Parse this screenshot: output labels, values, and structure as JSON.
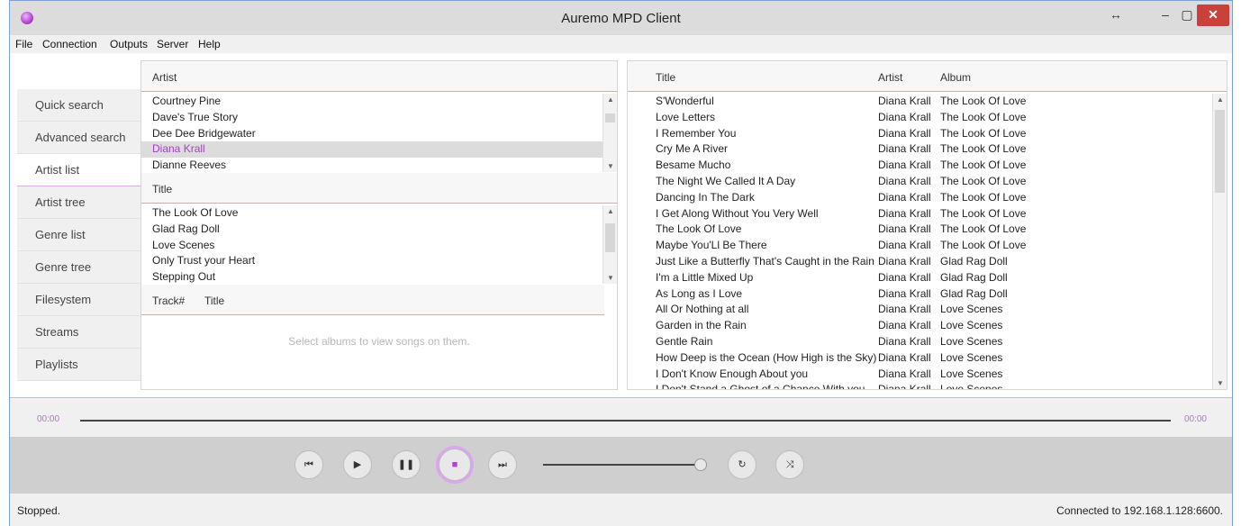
{
  "window": {
    "title": "Auremo MPD Client"
  },
  "titlebar_buttons": {
    "resize": "↔",
    "minimize": "–",
    "maximize": "▢",
    "close": "✕"
  },
  "menu": [
    "File",
    "Connection",
    "Outputs",
    "Server",
    "Help"
  ],
  "sidebar": [
    {
      "label": "Quick search"
    },
    {
      "label": "Advanced search"
    },
    {
      "label": "Artist list",
      "active": true
    },
    {
      "label": "Artist tree"
    },
    {
      "label": "Genre list"
    },
    {
      "label": "Genre tree"
    },
    {
      "label": "Filesystem"
    },
    {
      "label": "Streams"
    },
    {
      "label": "Playlists"
    }
  ],
  "artists": {
    "header": "Artist",
    "items": [
      "Courtney Pine",
      "Dave's True Story",
      "Dee Dee Bridgewater",
      "Diana Krall",
      "Dianne Reeves"
    ],
    "selected_index": 3
  },
  "albums": {
    "header": "Title",
    "items": [
      "The Look Of Love",
      "Glad Rag Doll",
      "Love Scenes",
      "Only Trust your Heart",
      "Stepping Out"
    ]
  },
  "tracks": {
    "header_track": "Track#",
    "header_title": "Title",
    "empty_message": "Select albums to view songs on them."
  },
  "songs": {
    "headers": {
      "title": "Title",
      "artist": "Artist",
      "album": "Album"
    },
    "rows": [
      {
        "title": "S'Wonderful",
        "artist": "Diana Krall",
        "album": "The Look Of Love"
      },
      {
        "title": "Love Letters",
        "artist": "Diana Krall",
        "album": "The Look Of Love"
      },
      {
        "title": "I Remember You",
        "artist": "Diana Krall",
        "album": "The Look Of Love"
      },
      {
        "title": "Cry Me A River",
        "artist": "Diana Krall",
        "album": "The Look Of Love"
      },
      {
        "title": "Besame Mucho",
        "artist": "Diana Krall",
        "album": "The Look Of Love"
      },
      {
        "title": "The Night We Called It A Day",
        "artist": "Diana Krall",
        "album": "The Look Of Love"
      },
      {
        "title": "Dancing In The Dark",
        "artist": "Diana Krall",
        "album": "The Look Of Love"
      },
      {
        "title": "I Get Along Without You Very Well",
        "artist": "Diana Krall",
        "album": "The Look Of Love"
      },
      {
        "title": "The Look Of Love",
        "artist": "Diana Krall",
        "album": "The Look Of Love"
      },
      {
        "title": "Maybe You'Ll Be There",
        "artist": "Diana Krall",
        "album": "The Look Of Love"
      },
      {
        "title": "Just Like a Butterfly That's Caught in the Rain",
        "artist": "Diana Krall",
        "album": "Glad Rag Doll"
      },
      {
        "title": "I'm a Little Mixed Up",
        "artist": "Diana Krall",
        "album": "Glad Rag Doll"
      },
      {
        "title": "As Long as I Love",
        "artist": "Diana Krall",
        "album": "Glad Rag Doll"
      },
      {
        "title": "All Or Nothing at all",
        "artist": "Diana Krall",
        "album": "Love Scenes"
      },
      {
        "title": "Garden in the Rain",
        "artist": "Diana Krall",
        "album": "Love Scenes"
      },
      {
        "title": "Gentle Rain",
        "artist": "Diana Krall",
        "album": "Love Scenes"
      },
      {
        "title": "How Deep is the Ocean (How High is the Sky)",
        "artist": "Diana Krall",
        "album": "Love Scenes"
      },
      {
        "title": "I Don't Know Enough About you",
        "artist": "Diana Krall",
        "album": "Love Scenes"
      },
      {
        "title": "I Don't Stand a Ghost of a Chance With you",
        "artist": "Diana Krall",
        "album": "Love Scenes"
      }
    ]
  },
  "playback": {
    "elapsed": "00:00",
    "total": "00:00",
    "buttons": {
      "previous": "⏮",
      "play": "▶",
      "pause": "❚❚",
      "stop": "■",
      "next": "⏭",
      "repeat": "↻",
      "shuffle": "⤨"
    },
    "volume_fraction": 1.0
  },
  "status": {
    "left": "Stopped.",
    "right": "Connected to 192.168.1.128:6600."
  },
  "colors": {
    "accent": "#a43fc4",
    "close_button": "#c9413a"
  }
}
